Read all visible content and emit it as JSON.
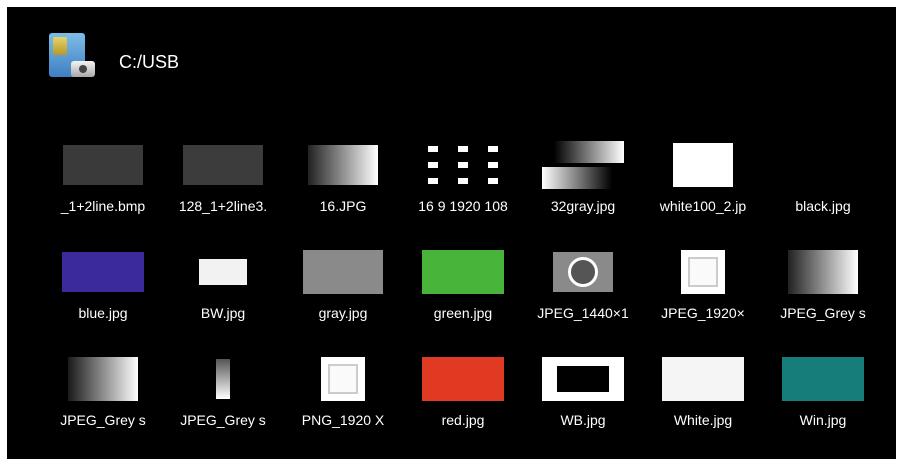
{
  "header": {
    "path": "C:/USB",
    "icon": "usb-folder-icon"
  },
  "files": [
    {
      "name": "_1+2line.bmp",
      "thumb": {
        "kind": "solid",
        "color": "#3a3a3a",
        "w": 80,
        "h": 40
      }
    },
    {
      "name": "128_1+2line3.",
      "thumb": {
        "kind": "solid",
        "color": "#3c3c3c",
        "w": 80,
        "h": 40
      }
    },
    {
      "name": "16.JPG",
      "thumb": {
        "kind": "grad",
        "from": "#222222",
        "to": "#ffffff",
        "w": 70,
        "h": 40
      }
    },
    {
      "name": "16 9 1920 108",
      "thumb": {
        "kind": "dots"
      }
    },
    {
      "name": "32gray.jpg",
      "thumb": {
        "kind": "steps"
      }
    },
    {
      "name": "white100_2.jp",
      "thumb": {
        "kind": "solid",
        "color": "#ffffff",
        "w": 60,
        "h": 44
      }
    },
    {
      "name": "black.jpg",
      "thumb": {
        "kind": "solid",
        "color": "#000000",
        "w": 70,
        "h": 40
      }
    },
    {
      "name": "blue.jpg",
      "thumb": {
        "kind": "solid",
        "color": "#3b2a9c",
        "w": 82,
        "h": 40
      }
    },
    {
      "name": "BW.jpg",
      "thumb": {
        "kind": "solid",
        "color": "#f2f2f2",
        "w": 48,
        "h": 26
      }
    },
    {
      "name": "gray.jpg",
      "thumb": {
        "kind": "solid",
        "color": "#8a8a8a",
        "w": 80,
        "h": 44
      }
    },
    {
      "name": "green.jpg",
      "thumb": {
        "kind": "solid",
        "color": "#48b53a",
        "w": 82,
        "h": 44
      }
    },
    {
      "name": "JPEG_1440×1",
      "thumb": {
        "kind": "chart"
      }
    },
    {
      "name": "JPEG_1920×",
      "thumb": {
        "kind": "framed"
      }
    },
    {
      "name": "JPEG_Grey s",
      "thumb": {
        "kind": "grad",
        "from": "#222222",
        "to": "#ffffff",
        "w": 70,
        "h": 44
      }
    },
    {
      "name": "JPEG_Grey s",
      "thumb": {
        "kind": "grad",
        "from": "#1a1a1a",
        "to": "#ffffff",
        "w": 70,
        "h": 44
      }
    },
    {
      "name": "JPEG_Grey s",
      "thumb": {
        "kind": "grad",
        "from": "#555555",
        "to": "#ffffff",
        "w": 14,
        "h": 40,
        "vertical": true
      }
    },
    {
      "name": "PNG_1920 X",
      "thumb": {
        "kind": "framed"
      }
    },
    {
      "name": "red.jpg",
      "thumb": {
        "kind": "solid",
        "color": "#e03a22",
        "w": 82,
        "h": 44
      }
    },
    {
      "name": "WB.jpg",
      "thumb": {
        "kind": "wb"
      }
    },
    {
      "name": "White.jpg",
      "thumb": {
        "kind": "solid",
        "color": "#f5f5f5",
        "w": 82,
        "h": 44
      }
    },
    {
      "name": "Win.jpg",
      "thumb": {
        "kind": "solid",
        "color": "#177d7a",
        "w": 82,
        "h": 44
      }
    }
  ]
}
